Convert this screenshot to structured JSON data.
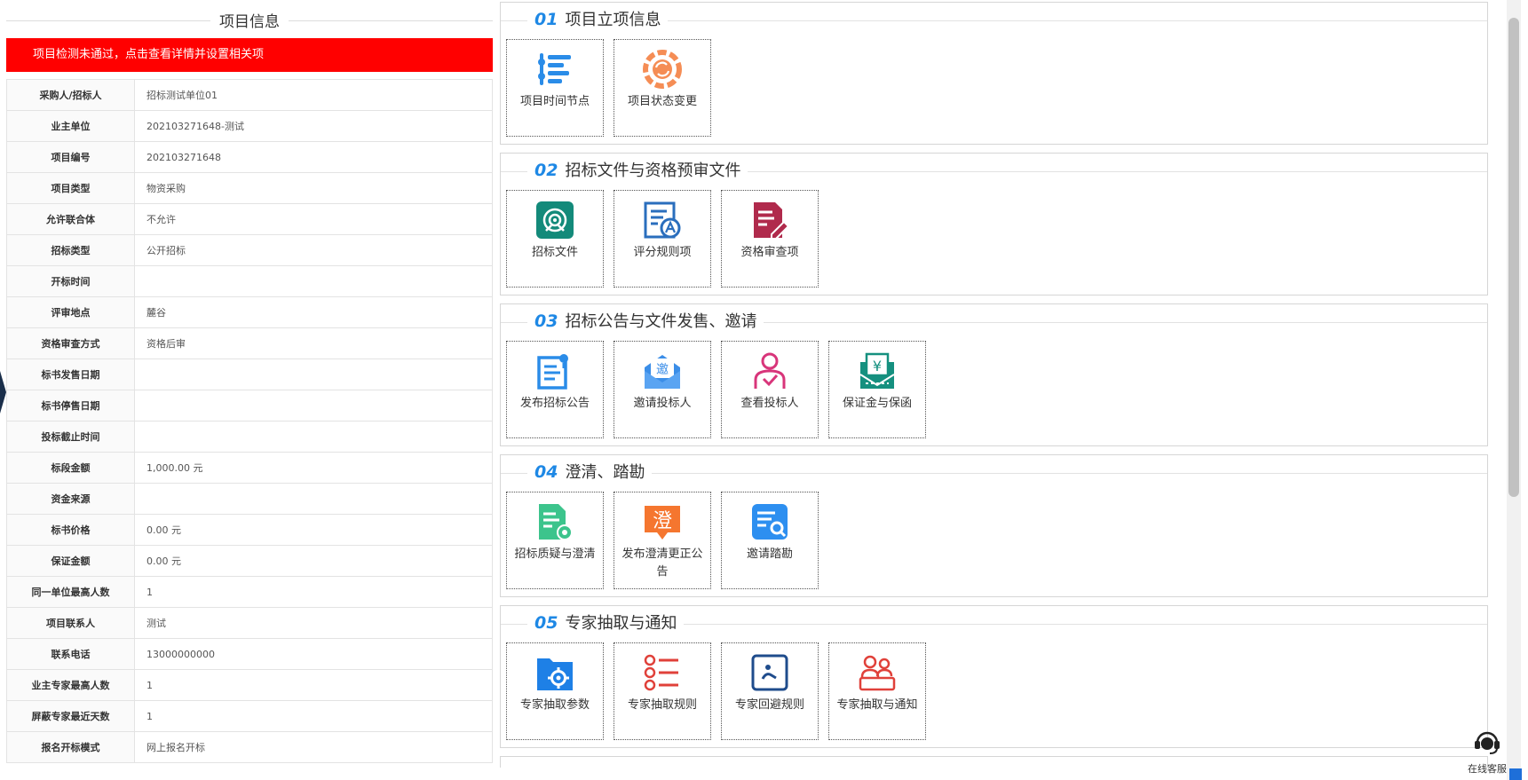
{
  "left": {
    "title": "项目信息",
    "alert": "项目检测未通过，点击查看详情并设置相关项",
    "rows": [
      {
        "label": "采购人/招标人",
        "value": "招标测试单位01"
      },
      {
        "label": "业主单位",
        "value": "202103271648-测试"
      },
      {
        "label": "项目编号",
        "value": "202103271648"
      },
      {
        "label": "项目类型",
        "value": "物资采购"
      },
      {
        "label": "允许联合体",
        "value": "不允许"
      },
      {
        "label": "招标类型",
        "value": "公开招标"
      },
      {
        "label": "开标时间",
        "value": ""
      },
      {
        "label": "评审地点",
        "value": "麓谷"
      },
      {
        "label": "资格审查方式",
        "value": "资格后审"
      },
      {
        "label": "标书发售日期",
        "value": ""
      },
      {
        "label": "标书停售日期",
        "value": ""
      },
      {
        "label": "投标截止时间",
        "value": ""
      },
      {
        "label": "标段金额",
        "value": "1,000.00 元"
      },
      {
        "label": "资金来源",
        "value": ""
      },
      {
        "label": "标书价格",
        "value": "0.00 元"
      },
      {
        "label": "保证金额",
        "value": "0.00 元"
      },
      {
        "label": "同一单位最高人数",
        "value": "1"
      },
      {
        "label": "项目联系人",
        "value": "测试"
      },
      {
        "label": "联系电话",
        "value": "13000000000"
      },
      {
        "label": "业主专家最高人数",
        "value": "1"
      },
      {
        "label": "屏蔽专家最近天数",
        "value": "1"
      },
      {
        "label": "报名开标模式",
        "value": "网上报名开标"
      }
    ]
  },
  "sections": [
    {
      "num": "01",
      "title": "项目立项信息",
      "tiles": [
        {
          "label": "项目时间节点",
          "icon": "timeline-icon",
          "color": "#2a8ce8"
        },
        {
          "label": "项目状态变更",
          "icon": "status-change-icon",
          "color": "#f58d55"
        }
      ]
    },
    {
      "num": "02",
      "title": "招标文件与资格预审文件",
      "tiles": [
        {
          "label": "招标文件",
          "icon": "target-doc-icon",
          "color": "#138a7a"
        },
        {
          "label": "评分规则项",
          "icon": "scoring-rule-icon",
          "color": "#2a6ebd"
        },
        {
          "label": "资格审查项",
          "icon": "qualification-icon",
          "color": "#b02a4c"
        }
      ]
    },
    {
      "num": "03",
      "title": "招标公告与文件发售、邀请",
      "tiles": [
        {
          "label": "发布招标公告",
          "icon": "publish-notice-icon",
          "color": "#2a8ce8"
        },
        {
          "label": "邀请投标人",
          "icon": "invite-mail-icon",
          "color": "#3b8ee8"
        },
        {
          "label": "查看投标人",
          "icon": "bidder-check-icon",
          "color": "#d8357a"
        },
        {
          "label": "保证金与保函",
          "icon": "deposit-icon",
          "color": "#15907f"
        }
      ]
    },
    {
      "num": "04",
      "title": "澄清、踏勘",
      "tiles": [
        {
          "label": "招标质疑与澄清",
          "icon": "doc-gear-icon",
          "color": "#3cc48c"
        },
        {
          "label": "发布澄清更正公告",
          "icon": "clarify-icon",
          "color": "#f5762f",
          "glyph": "澄"
        },
        {
          "label": "邀请踏勘",
          "icon": "doc-search-icon",
          "color": "#2d8ff0"
        }
      ]
    },
    {
      "num": "05",
      "title": "专家抽取与通知",
      "tiles": [
        {
          "label": "专家抽取参数",
          "icon": "folder-gear-icon",
          "color": "#1e80e6"
        },
        {
          "label": "专家抽取规则",
          "icon": "list-rule-icon",
          "color": "#e0413a"
        },
        {
          "label": "专家回避规则",
          "icon": "avoid-rule-icon",
          "color": "#1f4c8c"
        },
        {
          "label": "专家抽取与通知",
          "icon": "experts-notify-icon",
          "color": "#e0413a"
        }
      ]
    }
  ],
  "service": {
    "label": "在线客服",
    "icon": "headset-icon"
  }
}
